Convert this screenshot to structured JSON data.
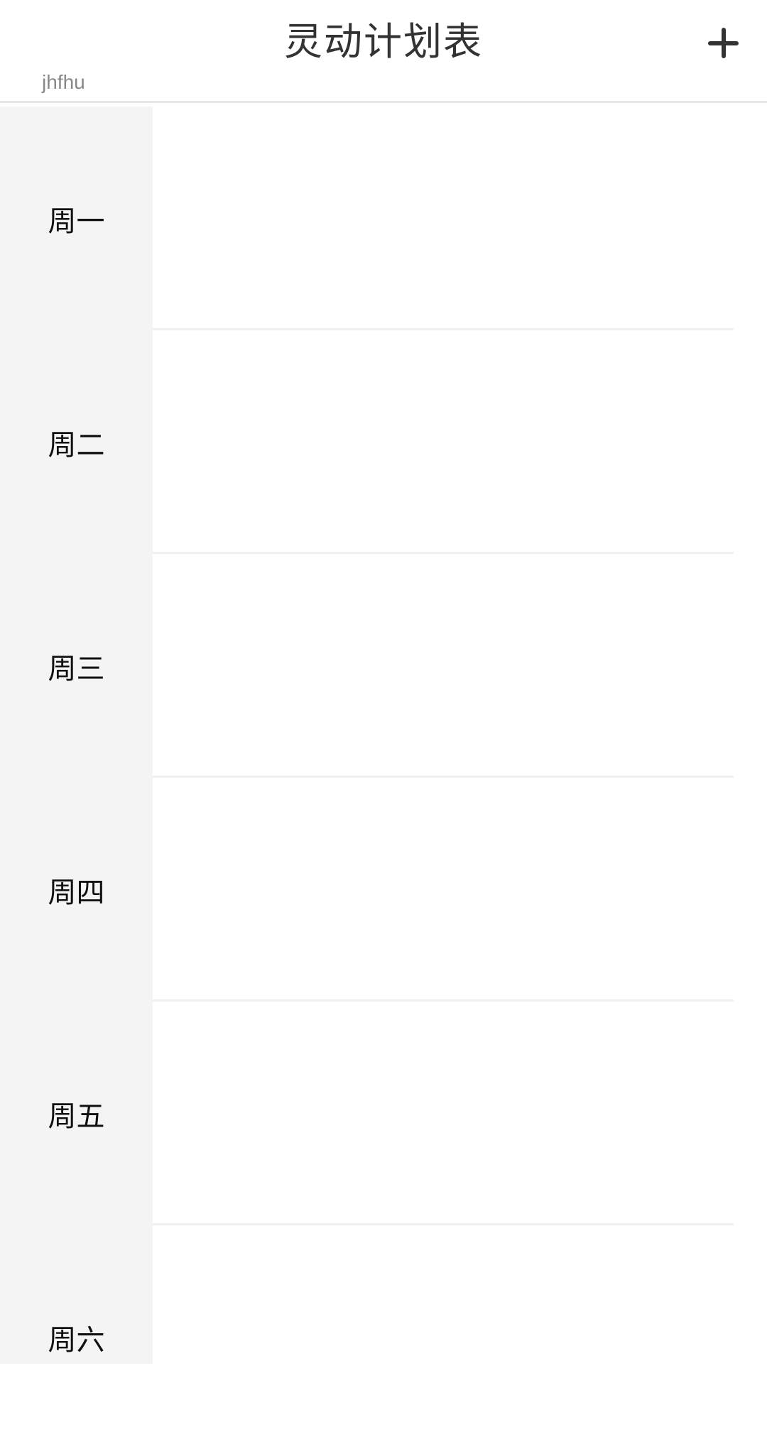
{
  "header": {
    "title": "灵动计划表",
    "subtitle": "jhfhu",
    "add_icon": "plus-icon"
  },
  "days": [
    {
      "label": "周一"
    },
    {
      "label": "周二"
    },
    {
      "label": "周三"
    },
    {
      "label": "周四"
    },
    {
      "label": "周五"
    },
    {
      "label": "周六"
    }
  ],
  "colors": {
    "header_bg": "#ffffff",
    "sidebar_bg": "#f4f4f4",
    "divider": "#f0f0f0",
    "title_text": "#333333",
    "subtitle_text": "#888888"
  }
}
